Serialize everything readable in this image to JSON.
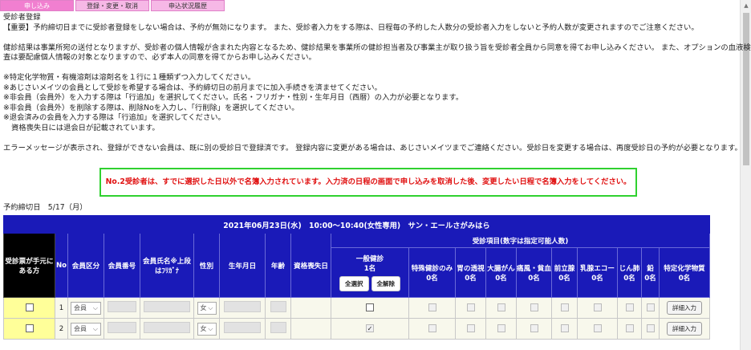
{
  "tabs": [
    "申し込み",
    "登録・変更・取消",
    "申込状況履歴"
  ],
  "page_title": "受診者登録",
  "notice_lines": [
    "【重要】予約締切日までに受診者登録をしない場合は、予約が無効になります。 また、受診者入力をする際は、日程毎の予約した人数分の受診者入力をしないと予約人数が変更されますのでご注意ください。",
    "健診結果は事業所宛の送付となりますが、受診者の個人情報が含まれた内容となるため、健診結果を事業所の健診担当者及び事業主が取り扱う旨を受診者全員から同意を得てお申し込みください。 また、オプションの血液検",
    "査は要配慮個人情報の対象となりますので、必ず本人の同意を得てからお申し込みください。",
    "※特定化学物質・有機溶剤は溶剤名を１行に１種類ずつ入力してください。",
    "※あじさいメイツの会員として受診を希望する場合は、予約締切日の前月までに加入手続きを済ませてください。",
    "※非会員（会員外）を入力する際は「行追加」を選択してください。氏名・フリガナ・性別・生年月日（西暦）の入力が必要となります。",
    "※非会員（会員外）を削除する際は、削除Noを入力し、「行削除」を選択してください。",
    "※退会済みの会員を入力する際は「行追加」を選択してください。",
    "資格喪失日には退会日が記載されています。",
    "エラーメッセージが表示され、登録ができない会員は、既に別の受診日で登録済です。 登録内容に変更がある場合は、あじさいメイツまでご連絡ください。受診日を変更する場合は、再度受診日の予約が必要となります。"
  ],
  "error_message": "No.2受診者は、すでに選択した日以外で名簿入力されています。入力済の日程の画面で申し込みを取消した後、変更したい日程で名簿入力をしてください。",
  "deadline": "予約締切日　5/17（月）",
  "table": {
    "banner": "2021年06月23日(水)　10:00～10:40(女性専用)　サン・エールさがみはら",
    "col_ticket": "受診票が手元にある方",
    "col_no": "No",
    "col_member_type": "会員区分",
    "col_member_no": "会員番号",
    "col_name": "会員氏名※上段はﾌﾘｶﾞﾅ",
    "col_sex": "性別",
    "col_dob": "生年月日",
    "col_age": "年齢",
    "col_lost": "資格喪失日",
    "items_header": "受診項目(数字は指定可能人数)",
    "general_label": "一般健診",
    "general_count": "1名",
    "select_all": "全選択",
    "clear_all": "全解除",
    "items": [
      {
        "label": "特殊健診のみ",
        "count": "0名"
      },
      {
        "label": "胃の透視",
        "count": "0名"
      },
      {
        "label": "大腸がん",
        "count": "0名"
      },
      {
        "label": "痛風・貧血",
        "count": "0名"
      },
      {
        "label": "前立腺",
        "count": "0名"
      },
      {
        "label": "乳腺エコー",
        "count": "0名"
      },
      {
        "label": "じん肺",
        "count": "0名"
      },
      {
        "label": "鉛",
        "count": "0名"
      },
      {
        "label": "特定化学物質",
        "count": "0名"
      }
    ],
    "rows": [
      {
        "no": "1",
        "member_type": "会員",
        "sex": "女",
        "general_checked": false,
        "detail": "詳細入力"
      },
      {
        "no": "2",
        "member_type": "会員",
        "sex": "女",
        "general_checked": true,
        "detail": "詳細入力"
      }
    ]
  },
  "colors": {
    "tab_active": "#f17fd0",
    "tab": "#f6b8e6",
    "header_blue": "#1a1ab8",
    "error_red": "#e01010",
    "error_border": "#2fd12f",
    "row_highlight": "#ffff99"
  }
}
